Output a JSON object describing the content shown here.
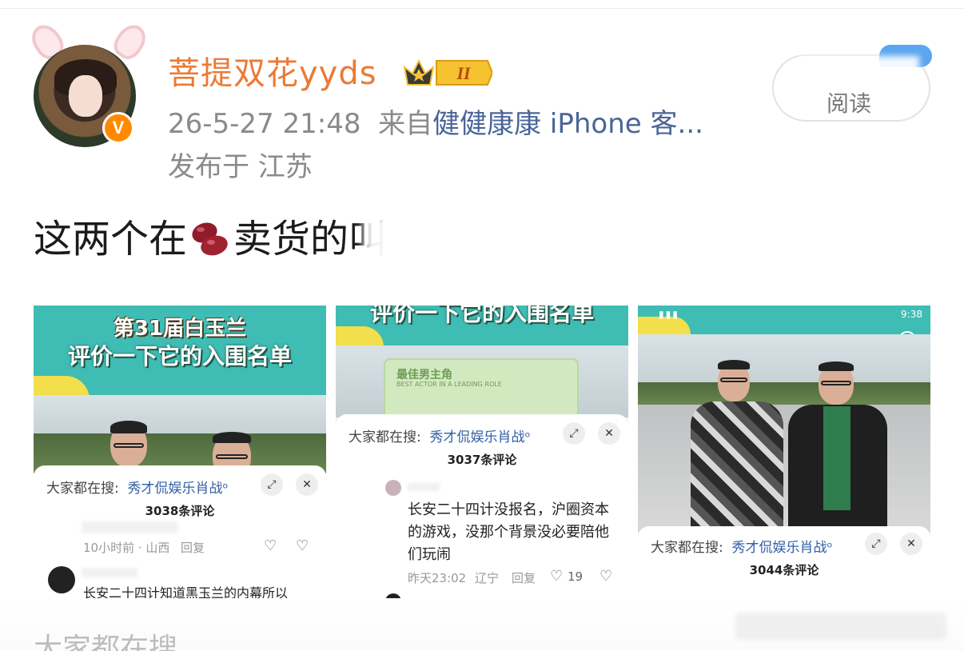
{
  "post": {
    "username": "菩提双花yyds",
    "level_badge": "II",
    "timestamp": "26-5-27 21:48",
    "source_prefix": "来自",
    "source_device": "健健康康 iPhone 客...",
    "location": "发布于  江苏",
    "read_button_label": "阅读",
    "verified_mark": "V",
    "text_before_emoji": "这两个在",
    "text_after_emoji": "卖货的叫",
    "emoji_icon": "red-bean-icon"
  },
  "images": [
    {
      "title_line1": "第31届白玉兰",
      "title_line2": "评价一下它的入围名单",
      "search_label": "大家都在搜:",
      "search_hot": "秀才侃娱乐肖战",
      "comment_count": "3038条评论",
      "comment_meta_time": "10小时前 · 山西",
      "reply_label": "回复",
      "comment_text": "长安二十四计知道黑玉兰的内幕所以"
    },
    {
      "title_line2": "评价一下它的入围名单",
      "card_title": "最佳男主角",
      "card_subtitle": "BEST ACTOR IN A LEADING ROLE",
      "search_label": "大家都在搜:",
      "search_hot": "秀才侃娱乐肖战",
      "comment_count": "3037条评论",
      "comment_text": "长安二十四计没报名，沪圈资本的游戏，没那个背景没必要陪他们玩闹",
      "comment_time": "昨天23:02",
      "comment_region": "辽宁",
      "reply_label": "回复",
      "like_count": "19"
    },
    {
      "status_time": "9:38",
      "search_label": "大家都在搜:",
      "search_hot": "秀才侃娱乐肖战",
      "comment_count": "3044条评论"
    }
  ],
  "footer": {
    "text": "大家都在搜"
  },
  "colors": {
    "username": "#eb7a35",
    "source_link": "#4a6598",
    "meta_gray": "#8a8a8a",
    "teal": "#3fbdb5",
    "hot_search": "#2f5fa5"
  }
}
